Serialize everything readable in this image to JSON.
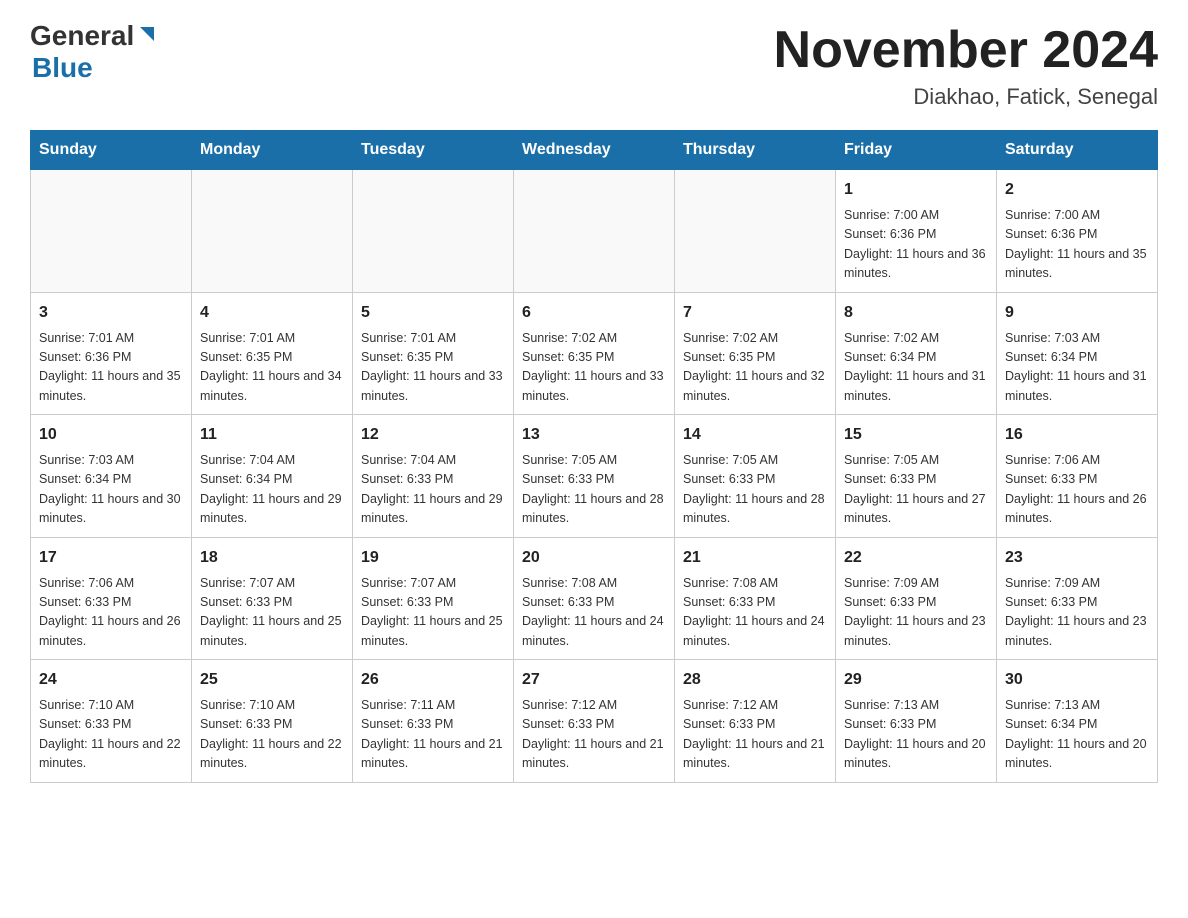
{
  "header": {
    "logo_general": "General",
    "logo_blue": "Blue",
    "title": "November 2024",
    "subtitle": "Diakhao, Fatick, Senegal"
  },
  "calendar": {
    "days_of_week": [
      "Sunday",
      "Monday",
      "Tuesday",
      "Wednesday",
      "Thursday",
      "Friday",
      "Saturday"
    ],
    "weeks": [
      [
        {
          "day": "",
          "info": ""
        },
        {
          "day": "",
          "info": ""
        },
        {
          "day": "",
          "info": ""
        },
        {
          "day": "",
          "info": ""
        },
        {
          "day": "",
          "info": ""
        },
        {
          "day": "1",
          "info": "Sunrise: 7:00 AM\nSunset: 6:36 PM\nDaylight: 11 hours and 36 minutes."
        },
        {
          "day": "2",
          "info": "Sunrise: 7:00 AM\nSunset: 6:36 PM\nDaylight: 11 hours and 35 minutes."
        }
      ],
      [
        {
          "day": "3",
          "info": "Sunrise: 7:01 AM\nSunset: 6:36 PM\nDaylight: 11 hours and 35 minutes."
        },
        {
          "day": "4",
          "info": "Sunrise: 7:01 AM\nSunset: 6:35 PM\nDaylight: 11 hours and 34 minutes."
        },
        {
          "day": "5",
          "info": "Sunrise: 7:01 AM\nSunset: 6:35 PM\nDaylight: 11 hours and 33 minutes."
        },
        {
          "day": "6",
          "info": "Sunrise: 7:02 AM\nSunset: 6:35 PM\nDaylight: 11 hours and 33 minutes."
        },
        {
          "day": "7",
          "info": "Sunrise: 7:02 AM\nSunset: 6:35 PM\nDaylight: 11 hours and 32 minutes."
        },
        {
          "day": "8",
          "info": "Sunrise: 7:02 AM\nSunset: 6:34 PM\nDaylight: 11 hours and 31 minutes."
        },
        {
          "day": "9",
          "info": "Sunrise: 7:03 AM\nSunset: 6:34 PM\nDaylight: 11 hours and 31 minutes."
        }
      ],
      [
        {
          "day": "10",
          "info": "Sunrise: 7:03 AM\nSunset: 6:34 PM\nDaylight: 11 hours and 30 minutes."
        },
        {
          "day": "11",
          "info": "Sunrise: 7:04 AM\nSunset: 6:34 PM\nDaylight: 11 hours and 29 minutes."
        },
        {
          "day": "12",
          "info": "Sunrise: 7:04 AM\nSunset: 6:33 PM\nDaylight: 11 hours and 29 minutes."
        },
        {
          "day": "13",
          "info": "Sunrise: 7:05 AM\nSunset: 6:33 PM\nDaylight: 11 hours and 28 minutes."
        },
        {
          "day": "14",
          "info": "Sunrise: 7:05 AM\nSunset: 6:33 PM\nDaylight: 11 hours and 28 minutes."
        },
        {
          "day": "15",
          "info": "Sunrise: 7:05 AM\nSunset: 6:33 PM\nDaylight: 11 hours and 27 minutes."
        },
        {
          "day": "16",
          "info": "Sunrise: 7:06 AM\nSunset: 6:33 PM\nDaylight: 11 hours and 26 minutes."
        }
      ],
      [
        {
          "day": "17",
          "info": "Sunrise: 7:06 AM\nSunset: 6:33 PM\nDaylight: 11 hours and 26 minutes."
        },
        {
          "day": "18",
          "info": "Sunrise: 7:07 AM\nSunset: 6:33 PM\nDaylight: 11 hours and 25 minutes."
        },
        {
          "day": "19",
          "info": "Sunrise: 7:07 AM\nSunset: 6:33 PM\nDaylight: 11 hours and 25 minutes."
        },
        {
          "day": "20",
          "info": "Sunrise: 7:08 AM\nSunset: 6:33 PM\nDaylight: 11 hours and 24 minutes."
        },
        {
          "day": "21",
          "info": "Sunrise: 7:08 AM\nSunset: 6:33 PM\nDaylight: 11 hours and 24 minutes."
        },
        {
          "day": "22",
          "info": "Sunrise: 7:09 AM\nSunset: 6:33 PM\nDaylight: 11 hours and 23 minutes."
        },
        {
          "day": "23",
          "info": "Sunrise: 7:09 AM\nSunset: 6:33 PM\nDaylight: 11 hours and 23 minutes."
        }
      ],
      [
        {
          "day": "24",
          "info": "Sunrise: 7:10 AM\nSunset: 6:33 PM\nDaylight: 11 hours and 22 minutes."
        },
        {
          "day": "25",
          "info": "Sunrise: 7:10 AM\nSunset: 6:33 PM\nDaylight: 11 hours and 22 minutes."
        },
        {
          "day": "26",
          "info": "Sunrise: 7:11 AM\nSunset: 6:33 PM\nDaylight: 11 hours and 21 minutes."
        },
        {
          "day": "27",
          "info": "Sunrise: 7:12 AM\nSunset: 6:33 PM\nDaylight: 11 hours and 21 minutes."
        },
        {
          "day": "28",
          "info": "Sunrise: 7:12 AM\nSunset: 6:33 PM\nDaylight: 11 hours and 21 minutes."
        },
        {
          "day": "29",
          "info": "Sunrise: 7:13 AM\nSunset: 6:33 PM\nDaylight: 11 hours and 20 minutes."
        },
        {
          "day": "30",
          "info": "Sunrise: 7:13 AM\nSunset: 6:34 PM\nDaylight: 11 hours and 20 minutes."
        }
      ]
    ]
  }
}
